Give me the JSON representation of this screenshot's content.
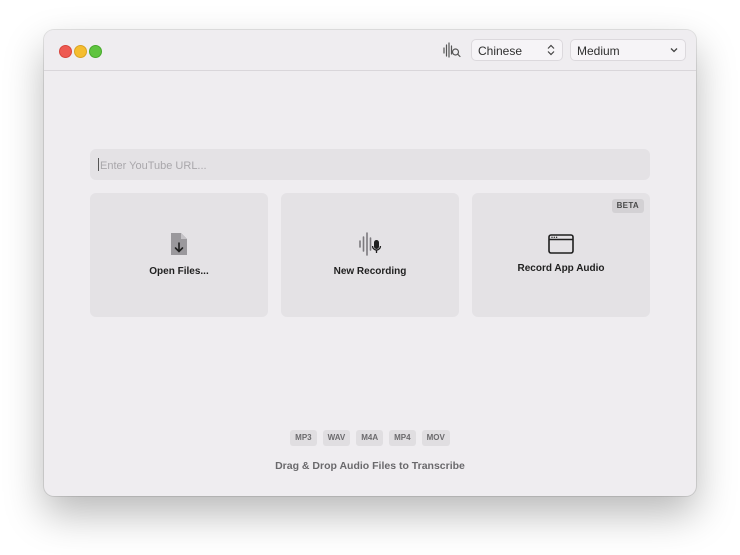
{
  "toolbar": {
    "language_select": "Chinese",
    "model_select": "Medium"
  },
  "url_input": {
    "placeholder": "Enter YouTube URL...",
    "value": ""
  },
  "actions": [
    {
      "label": "Open Files...",
      "icon": "file-download-icon"
    },
    {
      "label": "New Recording",
      "icon": "waveform-mic-icon"
    },
    {
      "label": "Record App Audio",
      "icon": "app-window-icon",
      "badge": "BETA"
    }
  ],
  "formats": [
    "MP3",
    "WAV",
    "M4A",
    "MP4",
    "MOV"
  ],
  "drop_hint": "Drag & Drop Audio Files to Transcribe",
  "colors": {
    "window_bg": "#efedf0",
    "card_bg": "#e4e2e5",
    "close": "#ee5a52",
    "minimize": "#f5bd2f",
    "zoom": "#5fc43f"
  }
}
